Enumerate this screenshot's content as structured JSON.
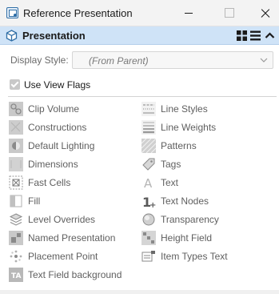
{
  "window": {
    "title": "Reference Presentation"
  },
  "section": {
    "title": "Presentation"
  },
  "display_style": {
    "label": "Display Style:",
    "value": "(From Parent)"
  },
  "use_view_flags": {
    "label": "Use View Flags",
    "checked": true
  },
  "flags_left": [
    {
      "label": "Clip Volume",
      "icon": "clip-volume-icon"
    },
    {
      "label": "Constructions",
      "icon": "constructions-icon"
    },
    {
      "label": "Default Lighting",
      "icon": "default-lighting-icon"
    },
    {
      "label": "Dimensions",
      "icon": "dimensions-icon"
    },
    {
      "label": "Fast Cells",
      "icon": "fast-cells-icon"
    },
    {
      "label": "Fill",
      "icon": "fill-icon"
    },
    {
      "label": "Level Overrides",
      "icon": "level-overrides-icon"
    },
    {
      "label": "Named Presentation",
      "icon": "named-presentation-icon"
    },
    {
      "label": "Placement Point",
      "icon": "placement-point-icon"
    },
    {
      "label": "Text Field background",
      "icon": "text-field-background-icon"
    }
  ],
  "flags_right": [
    {
      "label": "Line Styles",
      "icon": "line-styles-icon"
    },
    {
      "label": "Line Weights",
      "icon": "line-weights-icon"
    },
    {
      "label": "Patterns",
      "icon": "patterns-icon"
    },
    {
      "label": "Tags",
      "icon": "tags-icon"
    },
    {
      "label": "Text",
      "icon": "text-icon"
    },
    {
      "label": "Text Nodes",
      "icon": "text-nodes-icon"
    },
    {
      "label": "Transparency",
      "icon": "transparency-icon"
    },
    {
      "label": "Height Field",
      "icon": "height-field-icon"
    },
    {
      "label": "Item Types Text",
      "icon": "item-types-text-icon"
    }
  ],
  "colors": {
    "header_bg": "#cfe3f7",
    "accent": "#2f6ea6",
    "flag_text": "#5f5f5f"
  }
}
